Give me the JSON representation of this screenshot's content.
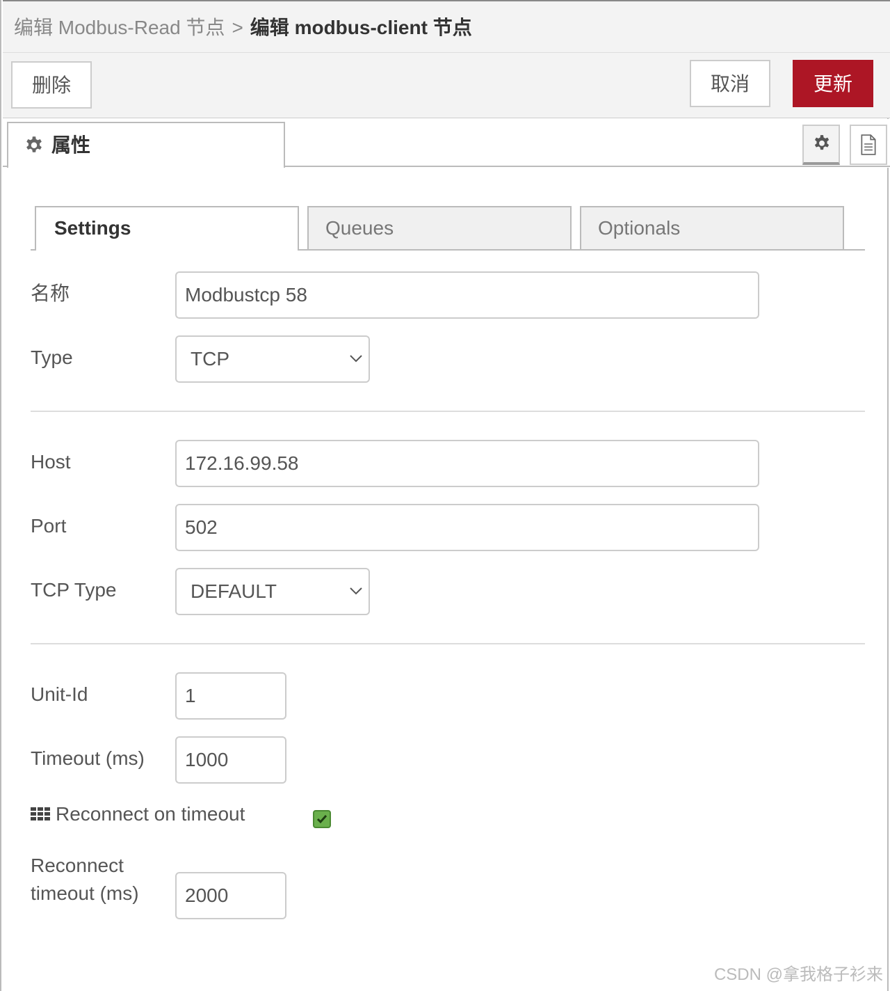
{
  "breadcrumb": {
    "parent": "编辑 Modbus-Read 节点",
    "separator": ">",
    "current": "编辑 modbus-client 节点"
  },
  "toolbar": {
    "delete_label": "删除",
    "cancel_label": "取消",
    "update_label": "更新"
  },
  "properties_tab": {
    "label": "属性",
    "icon": "gear-icon"
  },
  "icon_buttons": {
    "settings_icon": "gear-icon",
    "description_icon": "document-icon"
  },
  "inner_tabs": [
    {
      "label": "Settings",
      "active": true
    },
    {
      "label": "Queues",
      "active": false
    },
    {
      "label": "Optionals",
      "active": false
    }
  ],
  "form": {
    "name": {
      "label": "名称",
      "value": "Modbustcp 58"
    },
    "type": {
      "label": "Type",
      "value": "TCP"
    },
    "host": {
      "label": "Host",
      "value": "172.16.99.58"
    },
    "port": {
      "label": "Port",
      "value": "502"
    },
    "tcp_type": {
      "label": "TCP Type",
      "value": "DEFAULT"
    },
    "unit_id": {
      "label": "Unit-Id",
      "value": "1"
    },
    "timeout": {
      "label": "Timeout (ms)",
      "value": "1000"
    },
    "reconnect_on_timeout": {
      "label": "Reconnect on timeout",
      "checked": true,
      "icon": "grid-icon"
    },
    "reconnect_timeout": {
      "label_line1": "Reconnect",
      "label_line2": "timeout (ms)",
      "value": "2000"
    }
  },
  "colors": {
    "update_button": "#ad1625",
    "checkbox": "#6ab04c"
  },
  "watermark": "CSDN @拿我格子衫来"
}
